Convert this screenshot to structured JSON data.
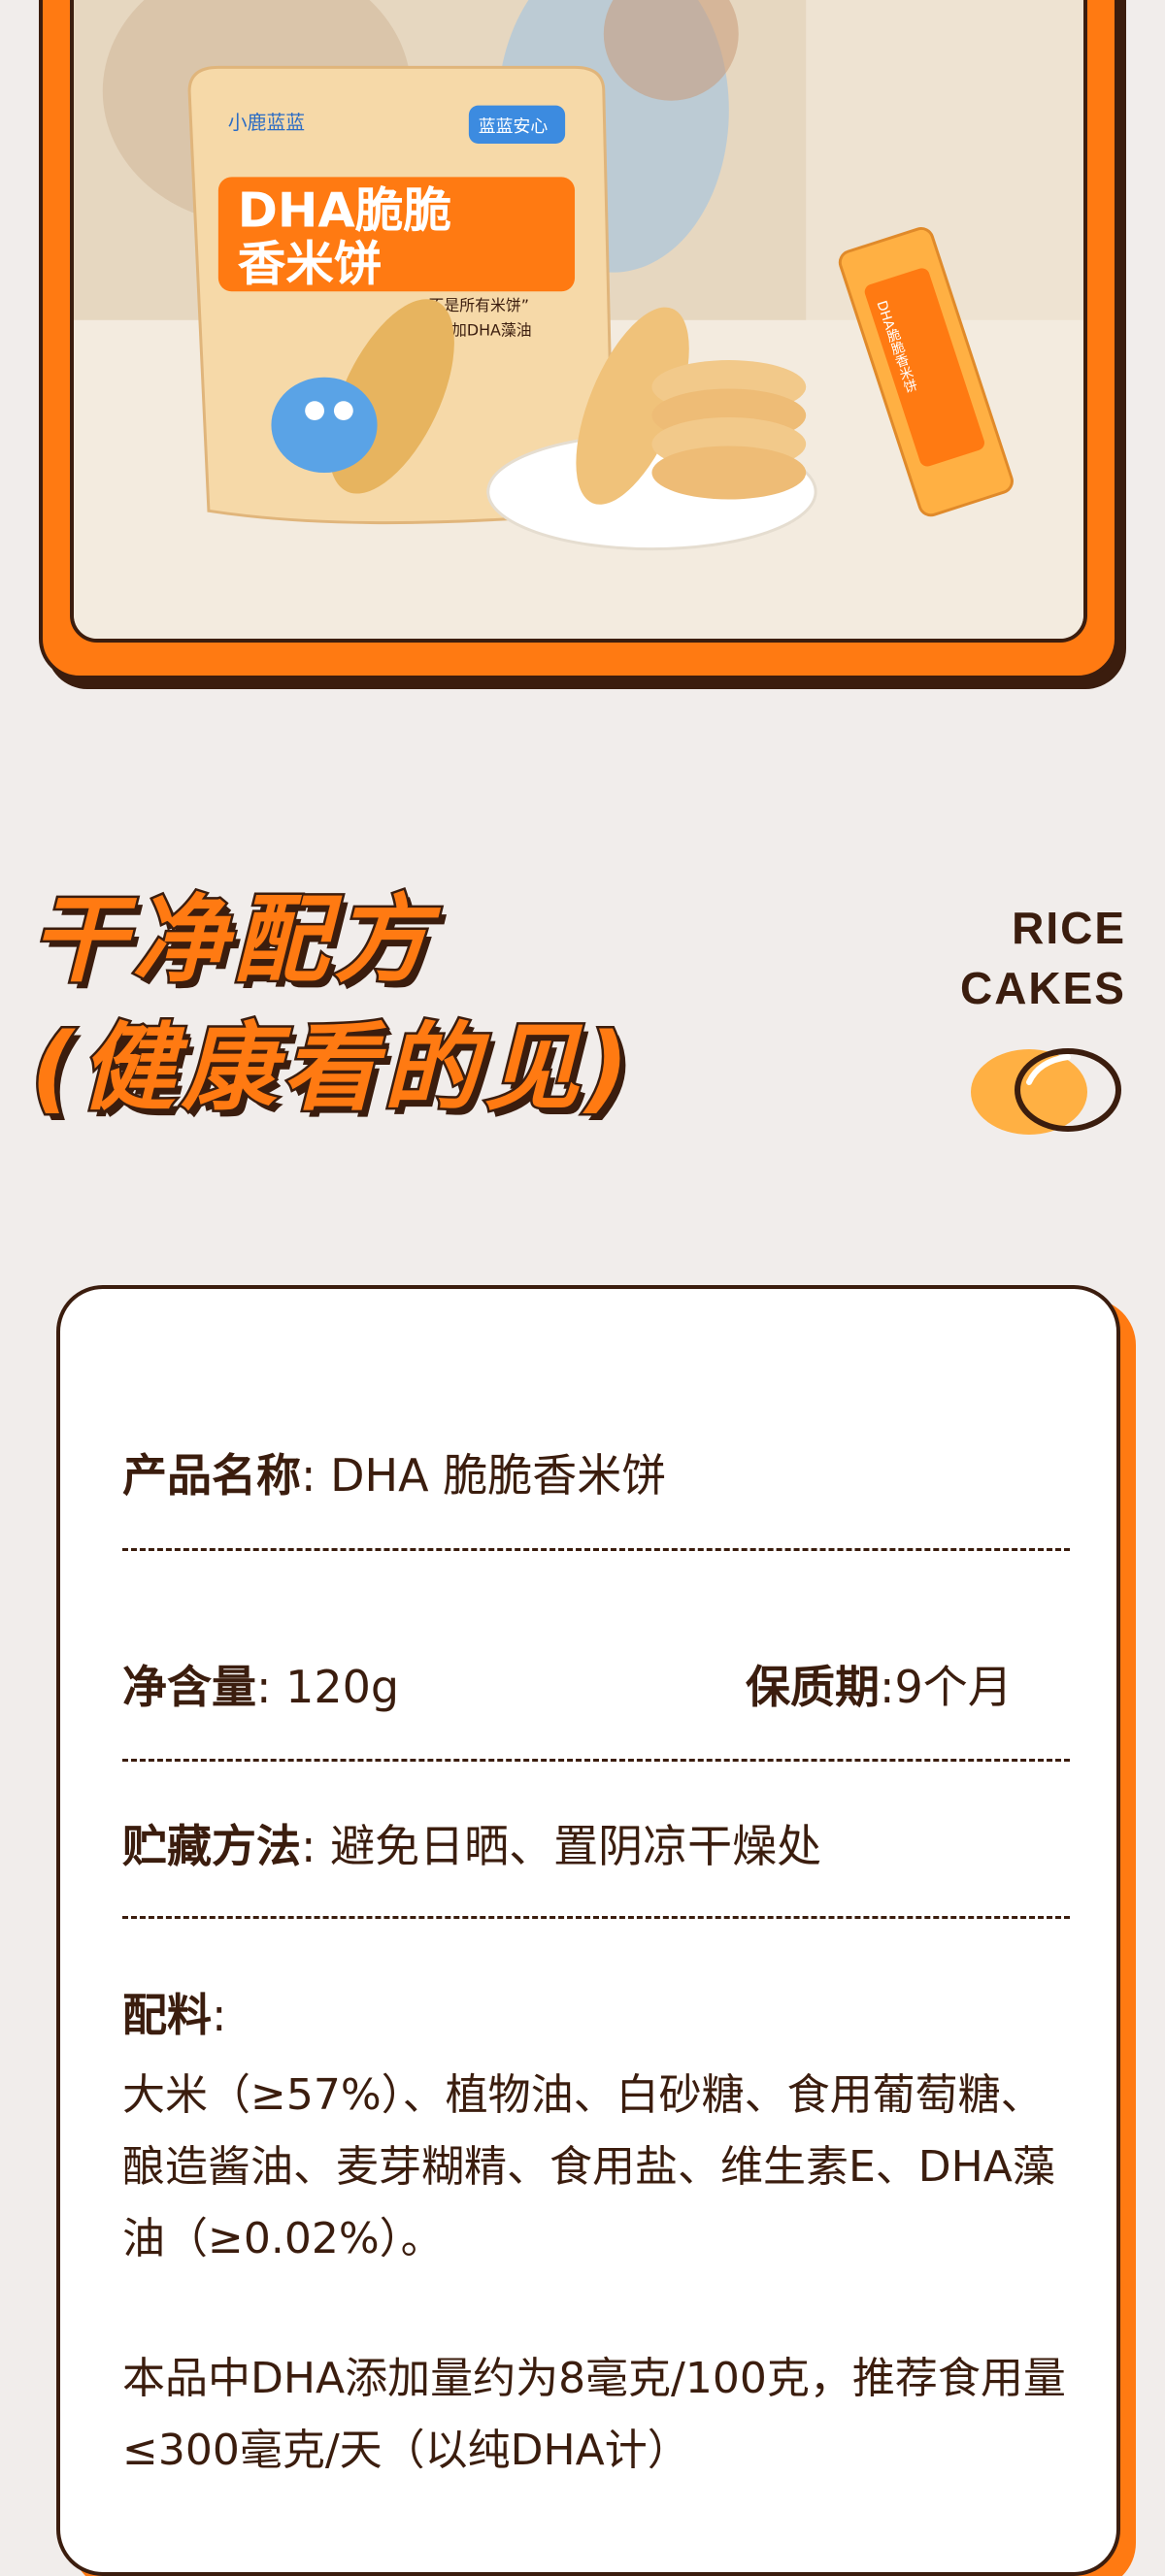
{
  "photo": {
    "brand_small": "小鹿蓝蓝",
    "pack_title_line1": "DHA脆脆",
    "pack_title_line2": "香米饼",
    "pack_tagline": "“不是所有米饼”",
    "pack_subline": "都添加DHA藻油",
    "badge": "蓝蓝安心",
    "single_pack_text": "DHA脆脆香米饼"
  },
  "heading": {
    "line1": "干净配方",
    "line2": "(健康看的见)",
    "side_line1": "RICE",
    "side_line2": "CAKES"
  },
  "info": {
    "name_label": "产品名称",
    "name_value": ": DHA 脆脆香米饼",
    "weight_label": "净含量",
    "weight_value": ": 120g",
    "shelf_label": "保质期",
    "shelf_value": ":9个月",
    "storage_label": "贮藏方法",
    "storage_value": ": 避免日晒、置阴凉干燥处",
    "ingredients_label": "配料",
    "ingredients_colon": ":",
    "ingredients_text": "大米（≥57%）、植物油、白砂糖、食用葡萄糖、酿造酱油、麦芽糊精、食用盐、维生素E、DHA藻油（≥0.02%）。",
    "dha_note": "本品中DHA添加量约为8毫克/100克，推荐食用量≤300毫克/天（以纯DHA计）"
  },
  "colors": {
    "accent": "#ff7a12",
    "dark": "#3b1d0e",
    "background": "#f1edeb"
  }
}
